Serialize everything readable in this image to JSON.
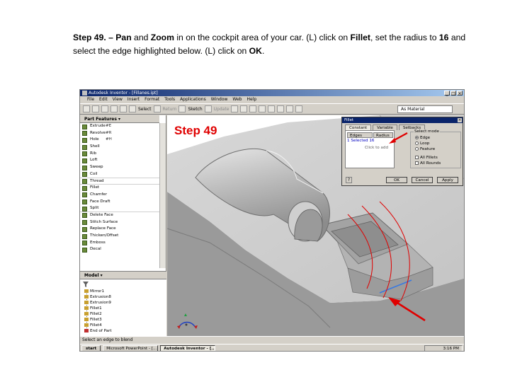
{
  "instructions": {
    "line1_pre": "Step 49. – ",
    "line1_pan": "Pan",
    "line1_and": " and ",
    "line1_zoom": "Zoom",
    "line1_mid": " in on the cockpit area of your car. (L) click on ",
    "line1_fillet": "Fillet",
    "line1_post": ", set the radius to ",
    "line1_radius": "16",
    "line1_end": " and",
    "line2_pre": "select the edge highlighted below. (L) click on ",
    "line2_ok": "OK",
    "line2_end": "."
  },
  "app": {
    "title": "Autodesk Inventor - [Fillanes.ipt]",
    "menus": [
      "File",
      "Edit",
      "View",
      "Insert",
      "Format",
      "Tools",
      "Applications",
      "Window",
      "Web",
      "Help"
    ],
    "toolbar": {
      "select": "Select",
      "return": "Return",
      "sketch": "Sketch",
      "update": "Update",
      "material": "As Material"
    }
  },
  "part_features": {
    "header": "Part Features ▾",
    "items": [
      {
        "label": "Extrude",
        "shortcut": "#E"
      },
      {
        "label": "Revolve",
        "shortcut": "#R"
      },
      {
        "label": "Hole",
        "shortcut": "#H"
      },
      {
        "label": "Shell",
        "shortcut": ""
      },
      {
        "label": "Rib",
        "shortcut": ""
      },
      {
        "label": "Loft",
        "shortcut": ""
      },
      {
        "label": "Sweep",
        "shortcut": ""
      },
      {
        "label": "Coil",
        "shortcut": ""
      },
      {
        "label": "Thread",
        "shortcut": ""
      },
      {
        "label": "Fillet",
        "shortcut": ""
      },
      {
        "label": "Chamfer",
        "shortcut": ""
      },
      {
        "label": "Face Draft",
        "shortcut": ""
      },
      {
        "label": "Split",
        "shortcut": ""
      },
      {
        "label": "Delete Face",
        "shortcut": ""
      },
      {
        "label": "Stitch Surface",
        "shortcut": ""
      },
      {
        "label": "Replace Face",
        "shortcut": ""
      },
      {
        "label": "Thicken/Offset",
        "shortcut": ""
      },
      {
        "label": "Emboss",
        "shortcut": ""
      },
      {
        "label": "Decal",
        "shortcut": ""
      }
    ]
  },
  "model": {
    "header": "Model ▾",
    "items": [
      "Mirror1",
      "Extrusion8",
      "Extrusion9",
      "Fillet1",
      "Fillet2",
      "Fillet3",
      "Fillet4",
      "End of Part"
    ]
  },
  "viewport": {
    "step_label": "Step 49"
  },
  "fillet_dialog": {
    "title": "Fillet",
    "tabs": [
      "Constant",
      "Variable",
      "Setbacks"
    ],
    "col_edges": "Edges",
    "col_radius": "Radius",
    "row": "1 Selected   16",
    "click_to_add": "Click to add",
    "select_mode_label": "Select mode",
    "modes": [
      "Edge",
      "Loop",
      "Feature"
    ],
    "selected_mode": "Edge",
    "checks": [
      "All Fillets",
      "All Rounds"
    ],
    "ok": "OK",
    "cancel": "Cancel",
    "apply": "Apply",
    "help": "?"
  },
  "status": {
    "text": "Select an edge to blend"
  },
  "taskbar": {
    "start": "start",
    "tasks": [
      {
        "label": "Microsoft PowerPoint - [...",
        "active": false
      },
      {
        "label": "Autodesk Inventor - [...",
        "active": true
      }
    ],
    "clock": "3:16 PM"
  },
  "colors": {
    "annotation_red": "#e00000",
    "titlebar": "#0a246a",
    "highlight_edge": "#3a7ae0"
  }
}
